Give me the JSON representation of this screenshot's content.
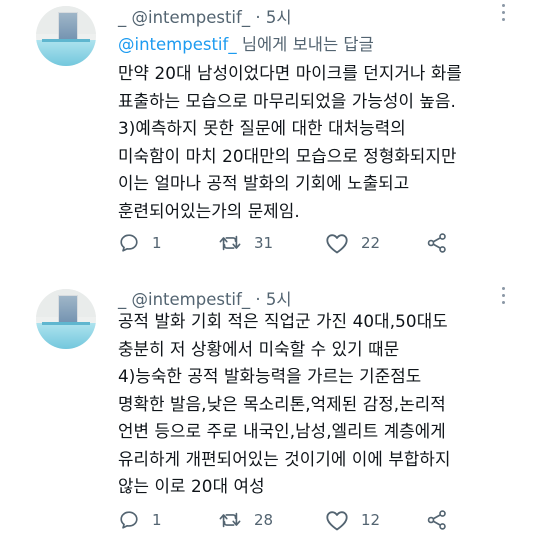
{
  "tweets": [
    {
      "handle": "@intempestif_",
      "separator": "·",
      "time": "5시",
      "reply_to": {
        "mention": "@intempestif_",
        "suffix": " 님에게 보내는 답글"
      },
      "lines": [
        "만약 20대 남성이었다면 마이크를 던지거나 화를",
        "표출하는 모습으로 마무리되었을 가능성이 높음.",
        "3)예측하지 못한 질문에 대한 대처능력의",
        "미숙함이 마치 20대만의 모습으로 정형화되지만",
        "이는 얼마나 공적 발화의 기회에 노출되고",
        "훈련되어있는가의 문제임."
      ],
      "stats": {
        "replies": "1",
        "retweets": "31",
        "likes": "22"
      }
    },
    {
      "handle": "@intempestif_",
      "separator": "·",
      "time": "5시",
      "lines": [
        "공적 발화 기회 적은 직업군 가진 40대,50대도",
        "충분히 저 상황에서 미숙할 수 있기 때문",
        "4)능숙한 공적 발화능력을 가르는 기준점도",
        "명확한 발음,낮은 목소리톤,억제된 감정,논리적",
        "언변 등으로 주로 내국인,남성,엘리트 계층에게",
        "유리하게 개편되어있는 것이기에 이에 부합하지",
        "않는 이로 20대 여성"
      ],
      "stats": {
        "replies": "1",
        "retweets": "28",
        "likes": "12"
      }
    }
  ],
  "icons": [
    "reply-icon",
    "retweet-icon",
    "like-icon",
    "share-icon",
    "more-icon"
  ],
  "colors": {
    "link": "#1d9bf0",
    "secondary": "#536471",
    "text": "#0f1419"
  }
}
